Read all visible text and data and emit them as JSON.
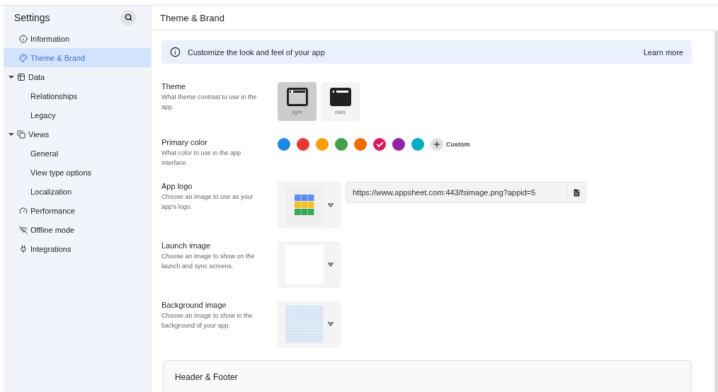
{
  "sidebar": {
    "title": "Settings",
    "items": [
      {
        "label": "Information",
        "selected": false
      },
      {
        "label": "Theme & Brand",
        "selected": true
      },
      {
        "label": "Data",
        "selected": false,
        "expanded": true,
        "children": [
          {
            "label": "Relationships",
            "selected": false
          },
          {
            "label": "Legacy",
            "selected": false
          }
        ]
      },
      {
        "label": "Views",
        "selected": false,
        "expanded": true,
        "children": [
          {
            "label": "General",
            "selected": false
          },
          {
            "label": "View type options",
            "selected": false
          },
          {
            "label": "Localization",
            "selected": false
          }
        ]
      },
      {
        "label": "Performance",
        "selected": false
      },
      {
        "label": "Offline mode",
        "selected": false
      },
      {
        "label": "Integrations",
        "selected": false
      }
    ]
  },
  "header": {
    "title": "Theme & Brand"
  },
  "banner": {
    "text": "Customize the look and feel of your app",
    "link": "Learn more"
  },
  "theme": {
    "label": "Theme",
    "description": "What theme contrast to use in the app.",
    "options": [
      {
        "label": "light",
        "kind": "light",
        "selected": true
      },
      {
        "label": "dark",
        "kind": "dark",
        "selected": false
      }
    ]
  },
  "primary_color": {
    "label": "Primary color",
    "description": "What color to use in the app interface.",
    "colors": [
      {
        "color": "#1e88e5",
        "selected": false
      },
      {
        "color": "#e53935",
        "selected": false
      },
      {
        "color": "#ffa000",
        "selected": false
      },
      {
        "color": "#43a047",
        "selected": false
      },
      {
        "color": "#ef6c00",
        "selected": false
      },
      {
        "color": "#d81b60",
        "selected": true
      },
      {
        "color": "#8e24aa",
        "selected": false
      },
      {
        "color": "#00acc1",
        "selected": false
      }
    ],
    "custom": "Custom"
  },
  "images": [
    {
      "label": "App logo",
      "description": "Choose an image to use as your app's logo.",
      "kind": "logo",
      "url": "https://www.appsheet.com:443/fsimage.png?appid=5"
    },
    {
      "label": "Launch image",
      "description": "Choose an image to show on the launch and sync screens.",
      "kind": "blank"
    },
    {
      "label": "Background image",
      "description": "Choose an image to show in the background of your app.",
      "kind": "grid"
    }
  ],
  "section": {
    "title": "Header & Footer"
  }
}
